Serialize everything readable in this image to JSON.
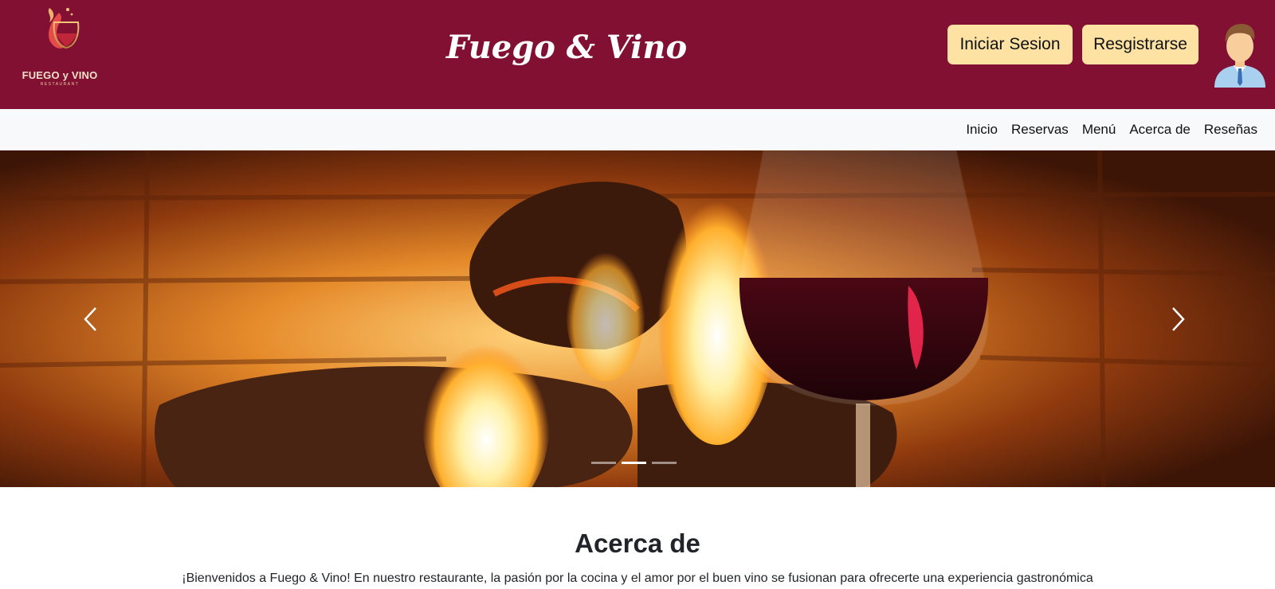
{
  "header": {
    "logo": {
      "brand_text": "FUEGO y VINO",
      "brand_sub": "RESTAURANT"
    },
    "title": "Fuego & Vino",
    "login_label": "Iniciar Sesion",
    "register_label": "Resgistrarse",
    "avatar_icon": "user-avatar-icon"
  },
  "nav": {
    "items": [
      {
        "label": "Inicio"
      },
      {
        "label": "Reservas"
      },
      {
        "label": "Menú"
      },
      {
        "label": "Acerca de"
      },
      {
        "label": "Reseñas"
      }
    ]
  },
  "carousel": {
    "prev_icon": "chevron-left-icon",
    "next_icon": "chevron-right-icon",
    "slide_count": 3,
    "active_slide": 2
  },
  "about": {
    "title": "Acerca de",
    "text": "¡Bienvenidos a Fuego & Vino! En nuestro restaurante, la pasión por la cocina y el amor por el buen vino se fusionan para ofrecerte una experiencia gastronómica"
  },
  "colors": {
    "header_bg": "#811033",
    "button_bg": "#fde2a4",
    "nav_bg": "#f8f9fa"
  }
}
